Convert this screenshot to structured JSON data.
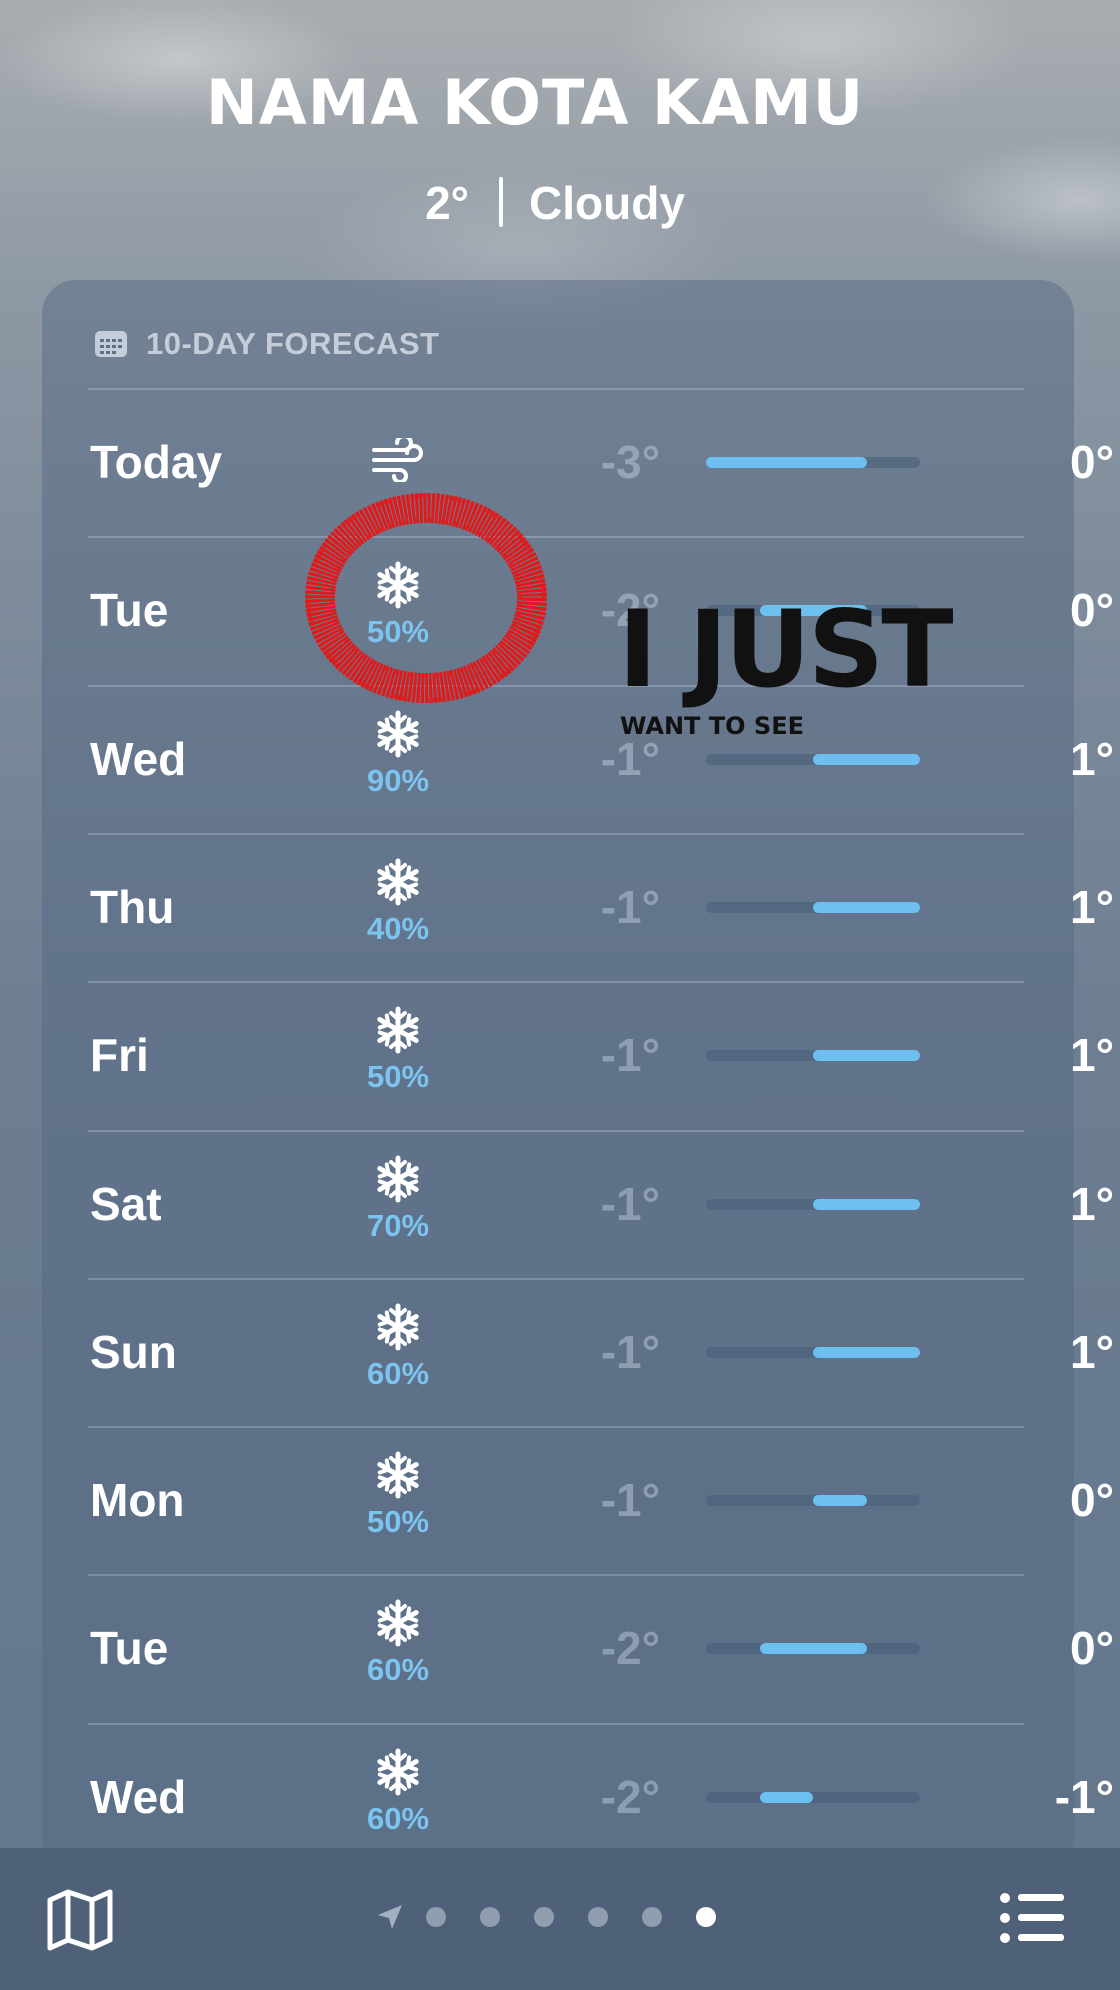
{
  "location": {
    "name": "NAMA KOTA KAMU",
    "temperature": "2°",
    "condition": "Cloudy"
  },
  "forecast": {
    "header": "10-DAY FORECAST",
    "scale": {
      "min": -3,
      "max": 1
    },
    "days": [
      {
        "day": "Today",
        "icon": "wind-icon",
        "precip": "",
        "low": "-3°",
        "high": "0°",
        "low_value": -3,
        "high_value": 0
      },
      {
        "day": "Tue",
        "icon": "snowflake-icon",
        "precip": "50%",
        "low": "-2°",
        "high": "0°",
        "low_value": -2,
        "high_value": 0
      },
      {
        "day": "Wed",
        "icon": "snowflake-icon",
        "precip": "90%",
        "low": "-1°",
        "high": "1°",
        "low_value": -1,
        "high_value": 1
      },
      {
        "day": "Thu",
        "icon": "snowflake-icon",
        "precip": "40%",
        "low": "-1°",
        "high": "1°",
        "low_value": -1,
        "high_value": 1
      },
      {
        "day": "Fri",
        "icon": "snowflake-icon",
        "precip": "50%",
        "low": "-1°",
        "high": "1°",
        "low_value": -1,
        "high_value": 1
      },
      {
        "day": "Sat",
        "icon": "snowflake-icon",
        "precip": "70%",
        "low": "-1°",
        "high": "1°",
        "low_value": -1,
        "high_value": 1
      },
      {
        "day": "Sun",
        "icon": "snowflake-icon",
        "precip": "60%",
        "low": "-1°",
        "high": "1°",
        "low_value": -1,
        "high_value": 1
      },
      {
        "day": "Mon",
        "icon": "snowflake-icon",
        "precip": "50%",
        "low": "-1°",
        "high": "0°",
        "low_value": -1,
        "high_value": 0
      },
      {
        "day": "Tue",
        "icon": "snowflake-icon",
        "precip": "60%",
        "low": "-2°",
        "high": "0°",
        "low_value": -2,
        "high_value": 0
      },
      {
        "day": "Wed",
        "icon": "snowflake-icon",
        "precip": "60%",
        "low": "-2°",
        "high": "-1°",
        "low_value": -2,
        "high_value": -1
      }
    ]
  },
  "overlay": {
    "big_text": "I JUST",
    "small_text": "WANT TO SEE",
    "circle_color": "#e01a1a"
  },
  "toolbar": {
    "map_icon": "map-icon",
    "list_icon": "list-icon",
    "location_icon": "location-arrow-icon",
    "page_count": 6,
    "active_page": 6
  },
  "colors": {
    "precip": "#7cc4f0",
    "bar": "#6cbfee",
    "bottom_bar": "#4f6178"
  }
}
